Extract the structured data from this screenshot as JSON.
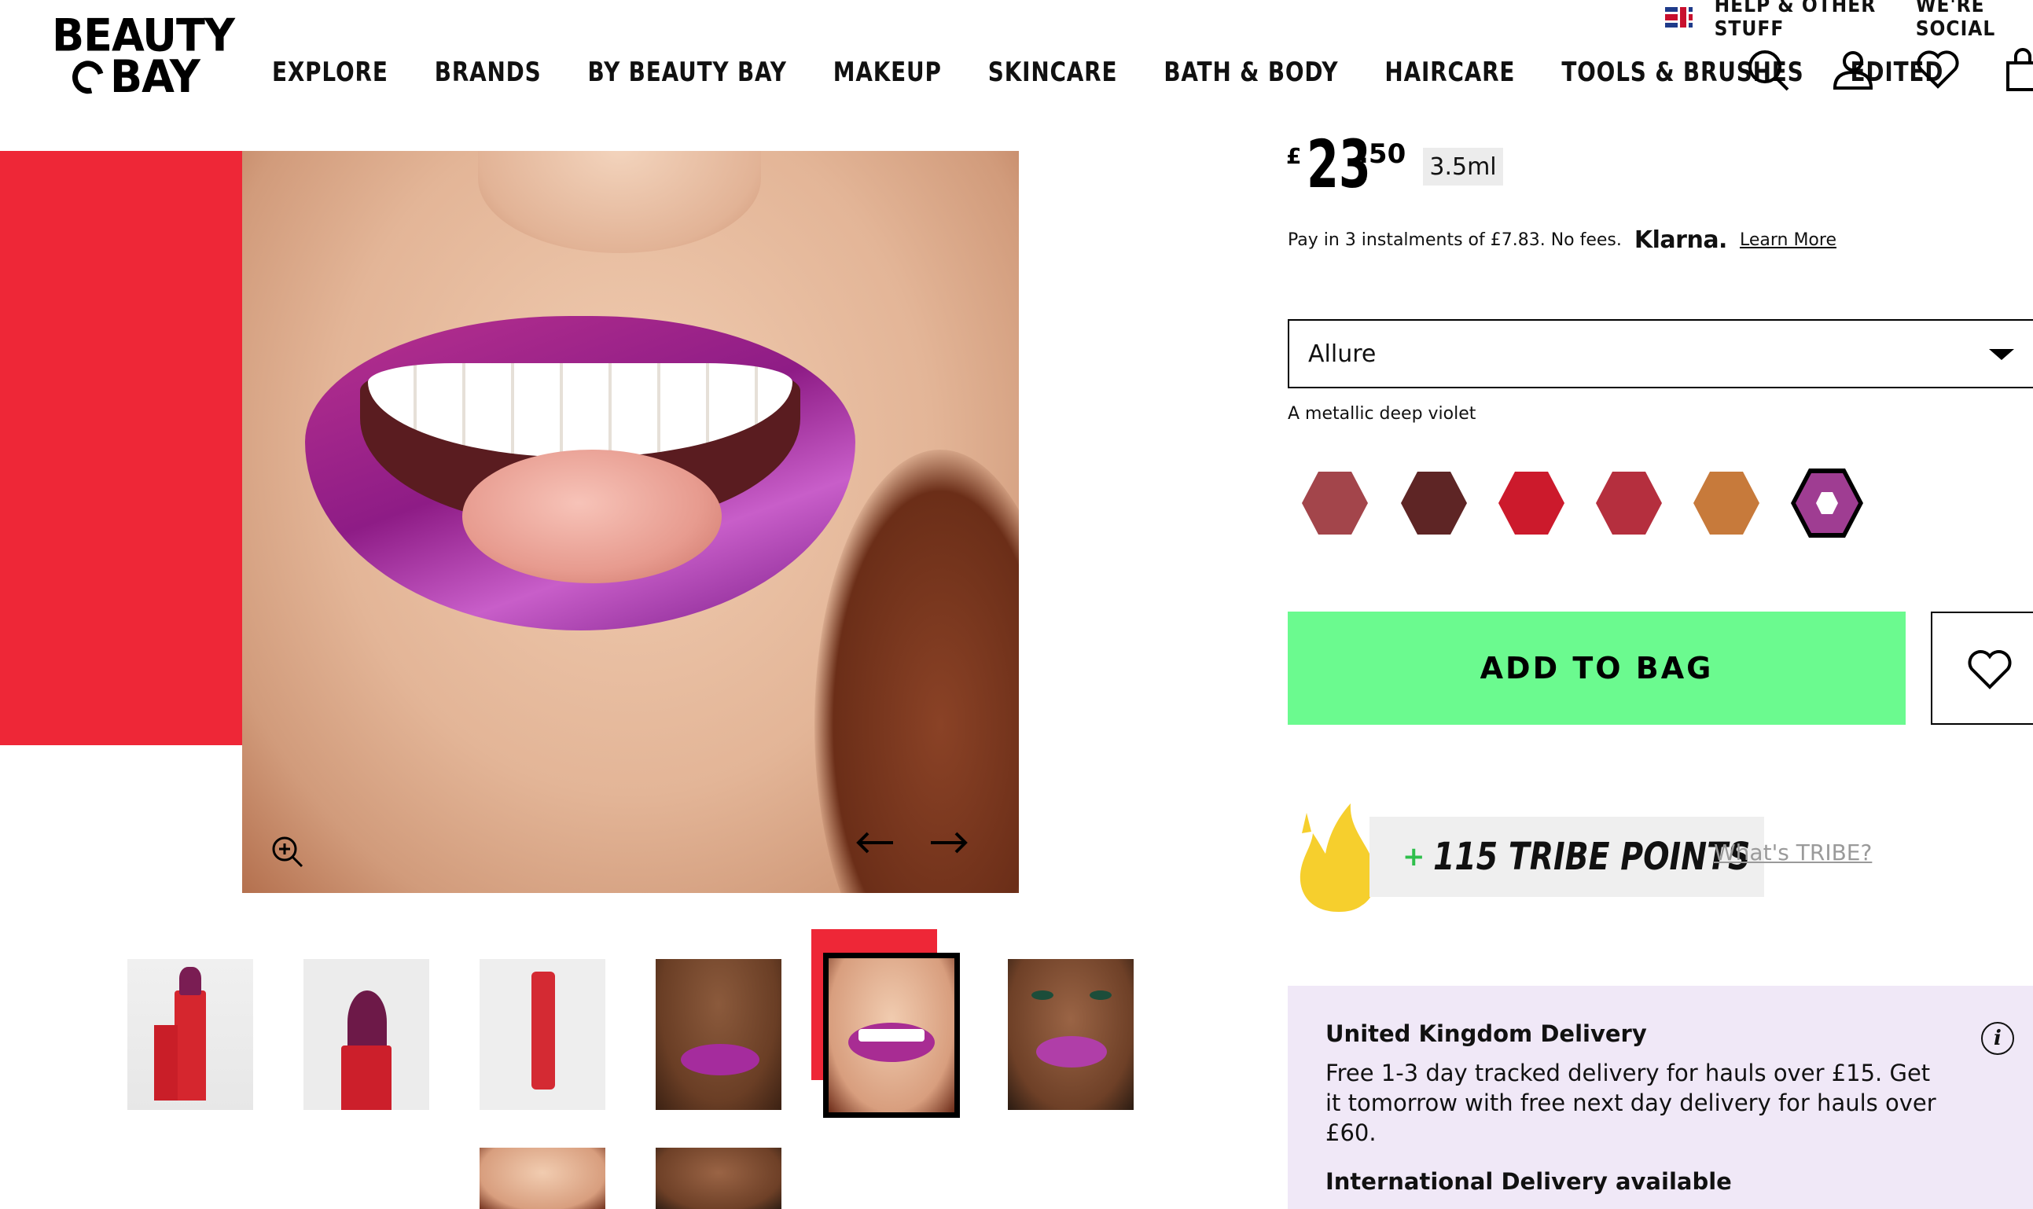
{
  "utility": {
    "help": "HELP & OTHER STUFF",
    "social": "WE'RE SOCIAL"
  },
  "logo": {
    "line1": "BEAUTY",
    "line2": "BAY"
  },
  "nav": [
    "EXPLORE",
    "BRANDS",
    "BY BEAUTY BAY",
    "MAKEUP",
    "SKINCARE",
    "BATH & BODY",
    "HAIRCARE",
    "TOOLS & BRUSHES",
    "EDITED"
  ],
  "header_icons": [
    "search-icon",
    "account-icon",
    "wishlist-heart-icon",
    "bag-icon"
  ],
  "product": {
    "currency": "£",
    "price_main": "23",
    "price_pence": ".50",
    "size": "3.5ml",
    "klarna_text": "Pay in 3 instalments of £7.83. No fees.",
    "klarna_brand": "Klarna.",
    "klarna_link": "Learn More",
    "selected_shade": "Allure",
    "shade_description": "A metallic deep violet",
    "swatch_colors": [
      "#a3454b",
      "#5e2525",
      "#cc1a2c",
      "#b52f3e",
      "#c77a3b",
      "#9f3d92"
    ],
    "selected_swatch_index": 5,
    "add_to_bag": "ADD TO BAG"
  },
  "tribe": {
    "points": "115 TRIBE POINTS",
    "plus": "+",
    "link": "What's TRIBE?"
  },
  "delivery": {
    "title": "United Kingdom Delivery",
    "body": "Free 1-3 day tracked delivery for hauls over £15. Get it tomorrow with free next day delivery for hauls over £60.",
    "international": "International Delivery available",
    "info_glyph": "i"
  },
  "colors": {
    "accent_red": "#ee2737",
    "add_button_green": "#6bfa8f",
    "delivery_bg": "#f0e8f7"
  }
}
